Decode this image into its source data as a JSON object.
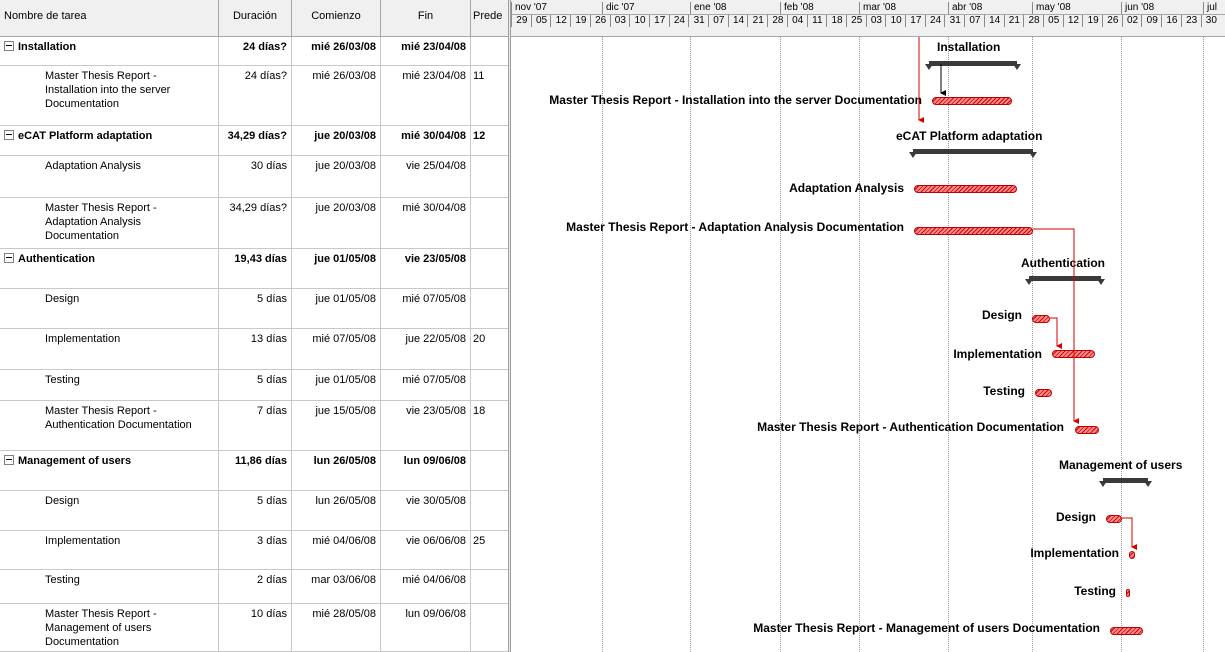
{
  "columns": {
    "name": "Nombre de tarea",
    "duration": "Duración",
    "start": "Comienzo",
    "finish": "Fin",
    "pred": "Prede"
  },
  "months": [
    "nov '07",
    "dic '07",
    "ene '08",
    "feb '08",
    "mar '08",
    "abr '08",
    "may '08",
    "jun '08",
    "jul"
  ],
  "weeks": [
    "29",
    "05",
    "12",
    "19",
    "26",
    "03",
    "10",
    "17",
    "24",
    "31",
    "07",
    "14",
    "21",
    "28",
    "04",
    "11",
    "18",
    "25",
    "03",
    "10",
    "17",
    "24",
    "31",
    "07",
    "14",
    "21",
    "28",
    "05",
    "12",
    "19",
    "26",
    "02",
    "09",
    "16",
    "23",
    "30"
  ],
  "tasks": [
    {
      "name": "Installation",
      "duration": "24 días?",
      "start": "mié 26/03/08",
      "finish": "mié 23/04/08",
      "pred": "",
      "summary": true
    },
    {
      "name": "Master Thesis Report - Installation into the server Documentation",
      "duration": "24 días?",
      "start": "mié 26/03/08",
      "finish": "mié 23/04/08",
      "pred": "11"
    },
    {
      "name": "eCAT Platform adaptation",
      "duration": "34,29 días?",
      "start": "jue 20/03/08",
      "finish": "mié 30/04/08",
      "pred": "12",
      "summary": true
    },
    {
      "name": "Adaptation Analysis",
      "duration": "30 días",
      "start": "jue 20/03/08",
      "finish": "vie 25/04/08",
      "pred": ""
    },
    {
      "name": "Master Thesis Report - Adaptation Analysis Documentation",
      "duration": "34,29 días?",
      "start": "jue 20/03/08",
      "finish": "mié 30/04/08",
      "pred": ""
    },
    {
      "name": "Authentication",
      "duration": "19,43 días",
      "start": "jue 01/05/08",
      "finish": "vie 23/05/08",
      "pred": "",
      "summary": true
    },
    {
      "name": "Design",
      "duration": "5 días",
      "start": "jue 01/05/08",
      "finish": "mié 07/05/08",
      "pred": ""
    },
    {
      "name": "Implementation",
      "duration": "13 días",
      "start": "mié 07/05/08",
      "finish": "jue 22/05/08",
      "pred": "20"
    },
    {
      "name": "Testing",
      "duration": "5 días",
      "start": "jue 01/05/08",
      "finish": "mié 07/05/08",
      "pred": ""
    },
    {
      "name": "Master Thesis Report - Authentication Documentation",
      "duration": "7 días",
      "start": "jue 15/05/08",
      "finish": "vie 23/05/08",
      "pred": "18"
    },
    {
      "name": "Management of users",
      "duration": "11,86 días",
      "start": "lun 26/05/08",
      "finish": "lun 09/06/08",
      "pred": "",
      "summary": true
    },
    {
      "name": "Design",
      "duration": "5 días",
      "start": "lun 26/05/08",
      "finish": "vie 30/05/08",
      "pred": ""
    },
    {
      "name": "Implementation",
      "duration": "3 días",
      "start": "mié 04/06/08",
      "finish": "vie 06/06/08",
      "pred": "25"
    },
    {
      "name": "Testing",
      "duration": "2 días",
      "start": "mar 03/06/08",
      "finish": "mié 04/06/08",
      "pred": ""
    },
    {
      "name": "Master Thesis Report - Management of users Documentation",
      "duration": "10 días",
      "start": "mié 28/05/08",
      "finish": "lun 09/06/08",
      "pred": ""
    }
  ]
}
